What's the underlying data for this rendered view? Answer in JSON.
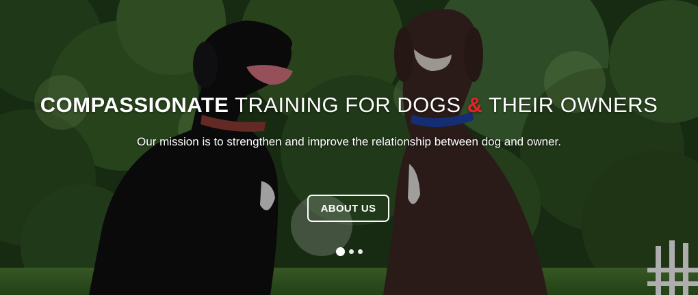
{
  "hero": {
    "headline": {
      "strong": "COMPASSIONATE",
      "rest1": "TRAINING FOR DOGS",
      "amp": "&",
      "rest2": "THEIR OWNERS"
    },
    "tagline": "Our mission is to strengthen and improve the relationship between dog and owner.",
    "cta_label": "ABOUT US",
    "slides": {
      "count": 3,
      "active": 1
    },
    "colors": {
      "accent": "#e3242b",
      "text": "#ffffff"
    },
    "image_description_icon": "two-dogs-photo"
  }
}
